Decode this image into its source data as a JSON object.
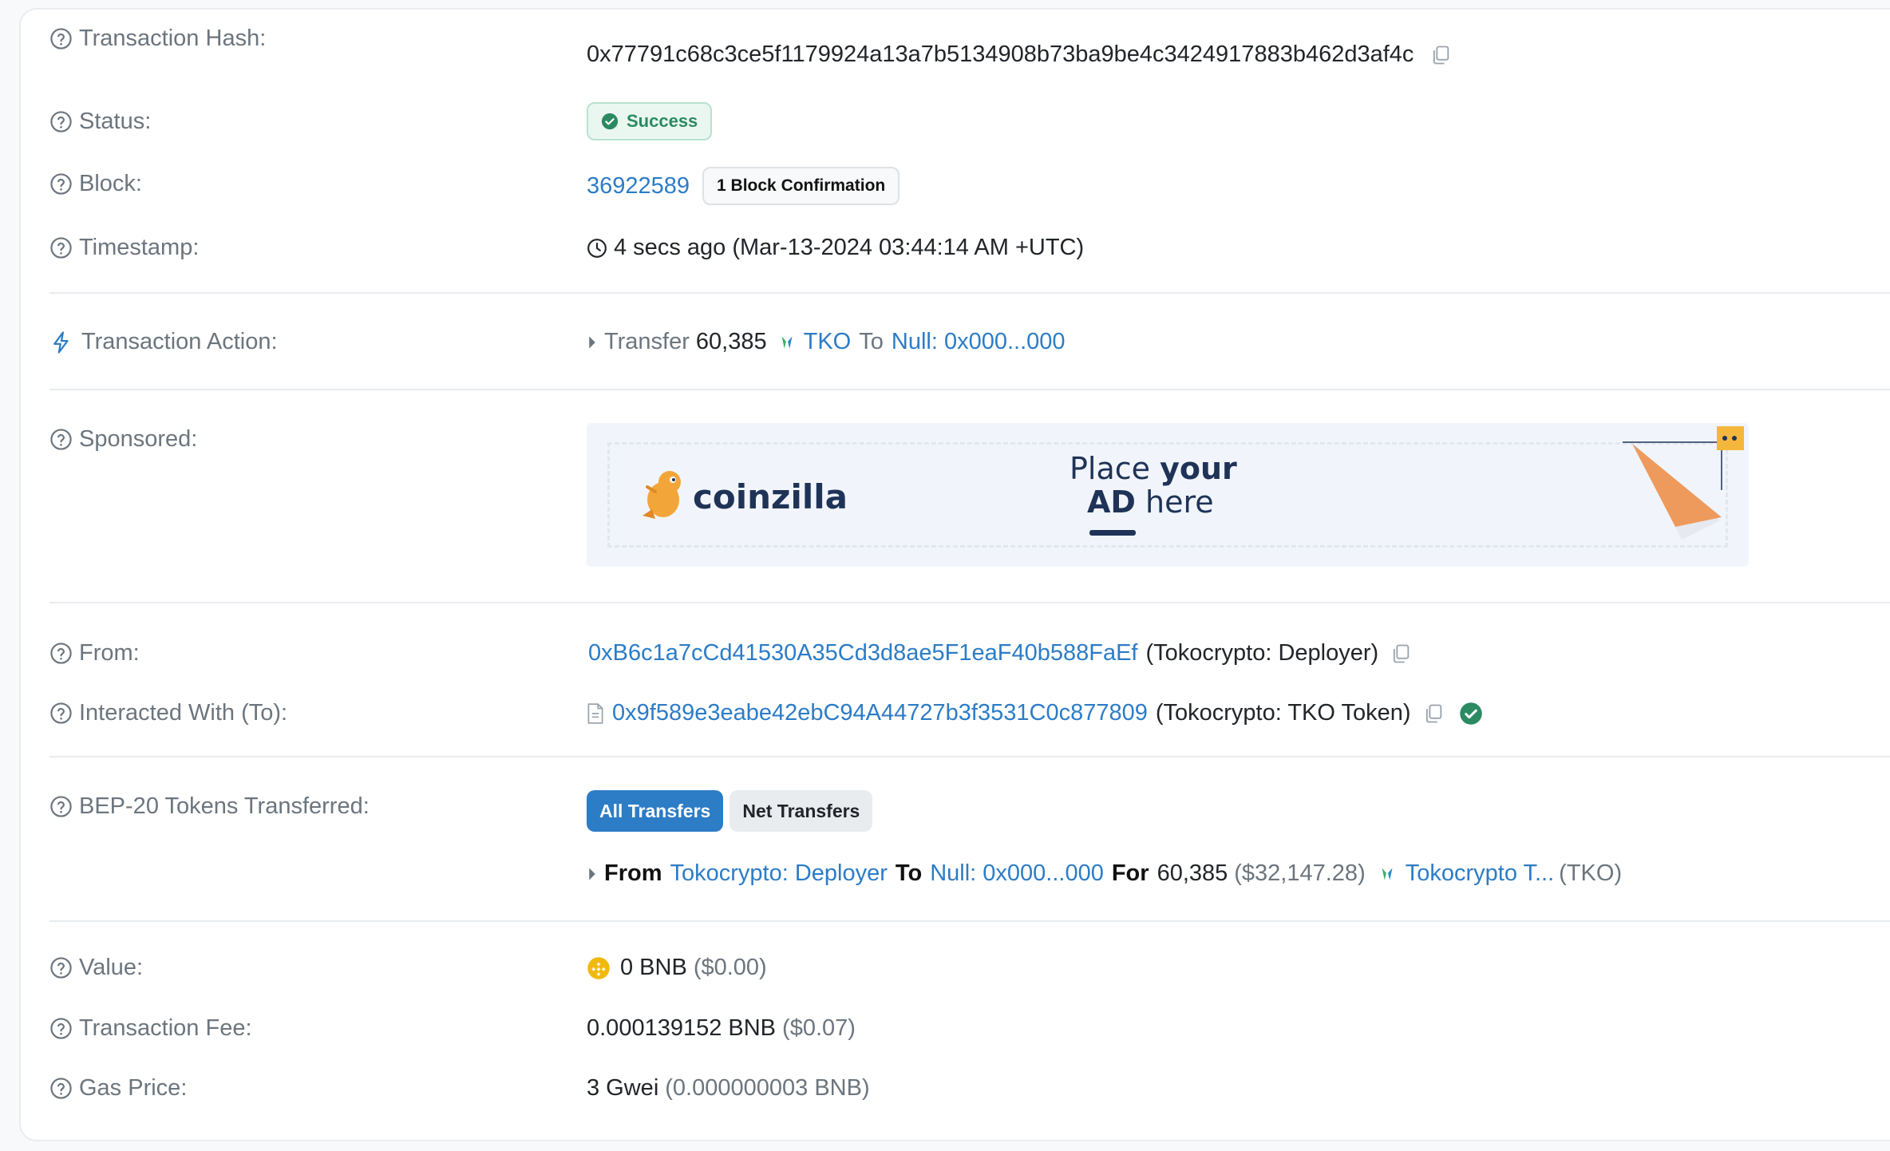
{
  "labels": {
    "tx_hash": "Transaction Hash:",
    "status": "Status:",
    "block": "Block:",
    "timestamp": "Timestamp:",
    "tx_action": "Transaction Action:",
    "sponsored": "Sponsored:",
    "from": "From:",
    "interacted_with": "Interacted With (To):",
    "bep20": "BEP-20 Tokens Transferred:",
    "value": "Value:",
    "tx_fee": "Transaction Fee:",
    "gas_price": "Gas Price:"
  },
  "tx_hash": "0x77791c68c3ce5f1179924a13a7b5134908b73ba9be4c3424917883b462d3af4c",
  "status": "Success",
  "block": {
    "number": "36922589",
    "confirmations": "1 Block Confirmation"
  },
  "timestamp": "4 secs ago (Mar-13-2024 03:44:14 AM +UTC)",
  "action": {
    "verb": "Transfer",
    "amount": "60,385",
    "token": "TKO",
    "to_word": "To",
    "to": "Null: 0x000...000"
  },
  "ad": {
    "brand": "coinzilla",
    "line1_a": "Place ",
    "line1_b": "your",
    "line2_a": "AD",
    "line2_b": " here"
  },
  "from": {
    "address": "0xB6c1a7cCd41530A35Cd3d8ae5F1eaF40b588FaEf",
    "tag": "(Tokocrypto: Deployer)"
  },
  "interacted": {
    "address": "0x9f589e3eabe42ebC94A44727b3f3531C0c877809",
    "tag": "(Tokocrypto: TKO Token)"
  },
  "tabs": {
    "all": "All Transfers",
    "net": "Net Transfers"
  },
  "transfer": {
    "from_word": "From",
    "from": "Tokocrypto: Deployer",
    "to_word": "To",
    "to": "Null: 0x000...000",
    "for_word": "For",
    "amount": "60,385",
    "usd": "($32,147.28)",
    "token_name": "Tokocrypto T...",
    "token_symbol": "(TKO)"
  },
  "value": {
    "amount": "0 BNB",
    "usd": "($0.00)"
  },
  "fee": {
    "amount": "0.000139152 BNB",
    "usd": "($0.07)"
  },
  "gas": {
    "amount": "3 Gwei",
    "bnb": "(0.000000003 BNB)"
  },
  "colors": {
    "link": "#2c7cc6",
    "success": "#2b8a62",
    "ad_orange": "#ee9a5c"
  },
  "icons": [
    "question-circle-icon",
    "copy-icon",
    "check-circle-icon",
    "clock-icon",
    "lightning-icon",
    "caret-right-icon",
    "tko-token-icon",
    "contract-file-icon",
    "verified-icon",
    "bnb-icon"
  ]
}
